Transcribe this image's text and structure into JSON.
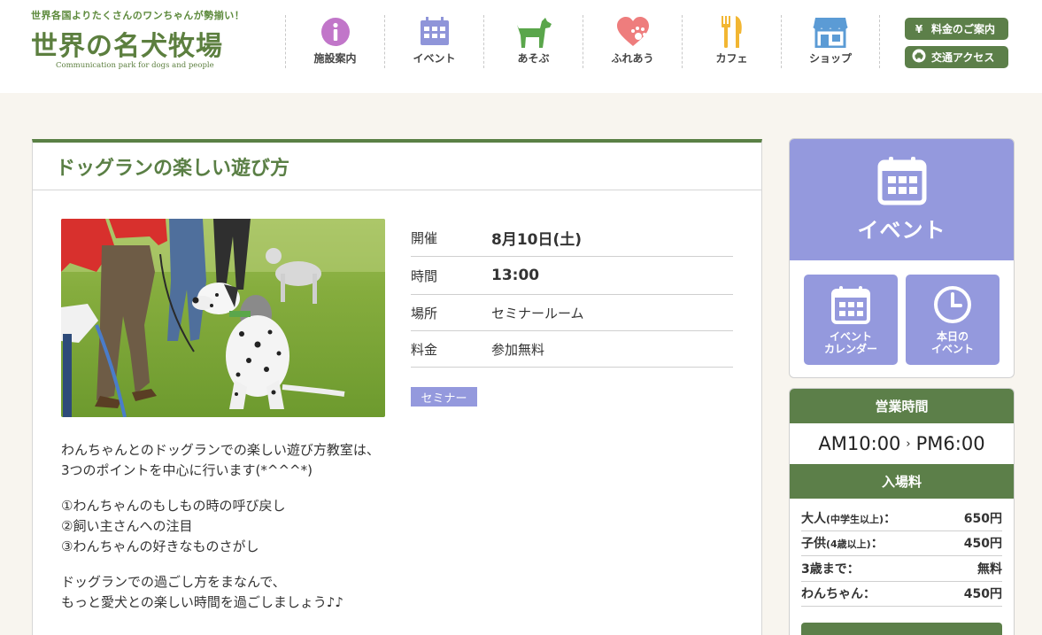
{
  "header": {
    "tagline": "世界各国よりたくさんのワンちゃんが勢揃い！",
    "logo_text": "世界の名犬牧場",
    "logo_sub": "Communication park for dogs and people",
    "nav": [
      {
        "label": "施設案内",
        "icon": "info-icon",
        "color": "#c176c9"
      },
      {
        "label": "イベント",
        "icon": "calendar-icon",
        "color": "#8f95d9"
      },
      {
        "label": "あそぶ",
        "icon": "dog-icon",
        "color": "#5aa64b"
      },
      {
        "label": "ふれあう",
        "icon": "heart-paw-icon",
        "color": "#ee7d7d"
      },
      {
        "label": "カフェ",
        "icon": "fork-knife-icon",
        "color": "#f2b632"
      },
      {
        "label": "ショップ",
        "icon": "shop-icon",
        "color": "#5b9bd5"
      }
    ],
    "fee_button": "料金のご案内",
    "access_button": "交通アクセス",
    "fee_icon": "¥"
  },
  "article": {
    "title": "ドッグランの楽しい遊び方",
    "info": [
      {
        "key": "開催",
        "value": "8月10日(土)"
      },
      {
        "key": "時間",
        "value": "13:00"
      },
      {
        "key": "場所",
        "value": "セミナールーム"
      },
      {
        "key": "料金",
        "value": "参加無料"
      }
    ],
    "tag": "セミナー",
    "paragraphs": [
      [
        "わんちゃんとのドッグランでの楽しい遊び方教室は、",
        "3つのポイントを中心に行います(*^^^*)"
      ],
      [
        "①わんちゃんのもしもの時の呼び戻し",
        "②飼い主さんへの注目",
        "③わんちゃんの好きなものさがし"
      ],
      [
        "ドッグランでの過ごし方をまなんで、",
        "もっと愛犬との楽しい時間を過ごしましょう♪♪"
      ]
    ]
  },
  "sidebar": {
    "event_title": "イベント",
    "event_calendar": [
      "イベント",
      "カレンダー"
    ],
    "today_event": [
      "本日の",
      "イベント"
    ],
    "hours_title": "営業時間",
    "open": "AM10:00",
    "arrow": "›",
    "close": "PM6:00",
    "fee_title": "入場料",
    "fees": [
      {
        "label": "大人",
        "note": "(中学生以上)",
        "colon": "：",
        "price": "650円"
      },
      {
        "label": "子供",
        "note": "(4歳以上)",
        "colon": "：",
        "price": "450円"
      },
      {
        "label": "3歳まで",
        "note": "",
        "colon": "：",
        "price": "無料"
      },
      {
        "label": "わんちゃん",
        "note": "",
        "colon": "：",
        "price": "450円"
      }
    ],
    "accent": "#5c7f49",
    "event_color": "#9499dd"
  }
}
